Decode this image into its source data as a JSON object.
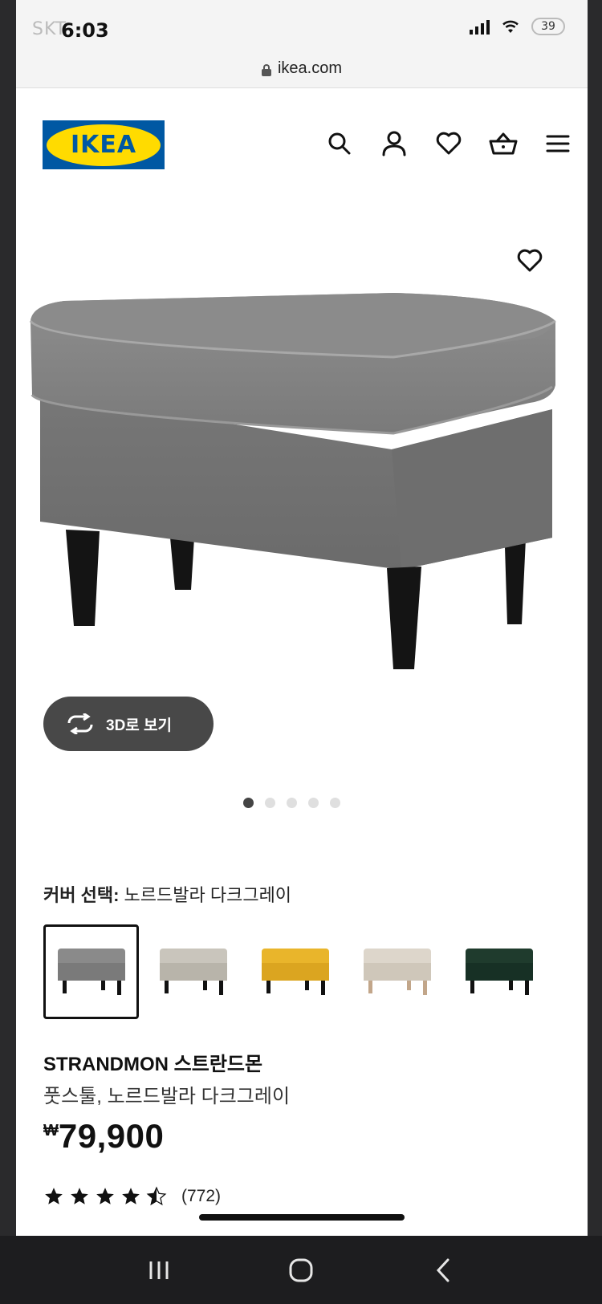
{
  "status_bar": {
    "time": "6:03",
    "carrier": "SKT",
    "battery": "39"
  },
  "browser": {
    "url": "ikea.com"
  },
  "header": {
    "logo_text": "IKEA",
    "logo_colors": {
      "blue": "#0058a3",
      "yellow": "#ffdb00"
    },
    "icons": [
      "search-icon",
      "account-icon",
      "wishlist-heart-icon",
      "shopping-basket-icon",
      "menu-icon"
    ]
  },
  "gallery": {
    "button_3d_label": "3D로 보기",
    "dot_count": 5,
    "active_dot": 0
  },
  "cover": {
    "label": "커버 선택:",
    "selected_value": "노르드발라 다크그레이",
    "swatches": [
      {
        "name": "dark-grey",
        "color": "#8a8a8a",
        "selected": true
      },
      {
        "name": "houndstooth",
        "color": "#c9c5bc",
        "selected": false
      },
      {
        "name": "yellow",
        "color": "#e9b52b",
        "selected": false
      },
      {
        "name": "beige",
        "color": "#ddd6cb",
        "selected": false
      },
      {
        "name": "dark-green",
        "color": "#1f3b2d",
        "selected": false
      }
    ]
  },
  "product": {
    "name": "STRANDMON 스트란드몬",
    "description": "풋스툴, 노르드발라 다크그레이",
    "currency": "₩",
    "price": "79,900",
    "rating": 4.5,
    "review_count": "(772)"
  }
}
